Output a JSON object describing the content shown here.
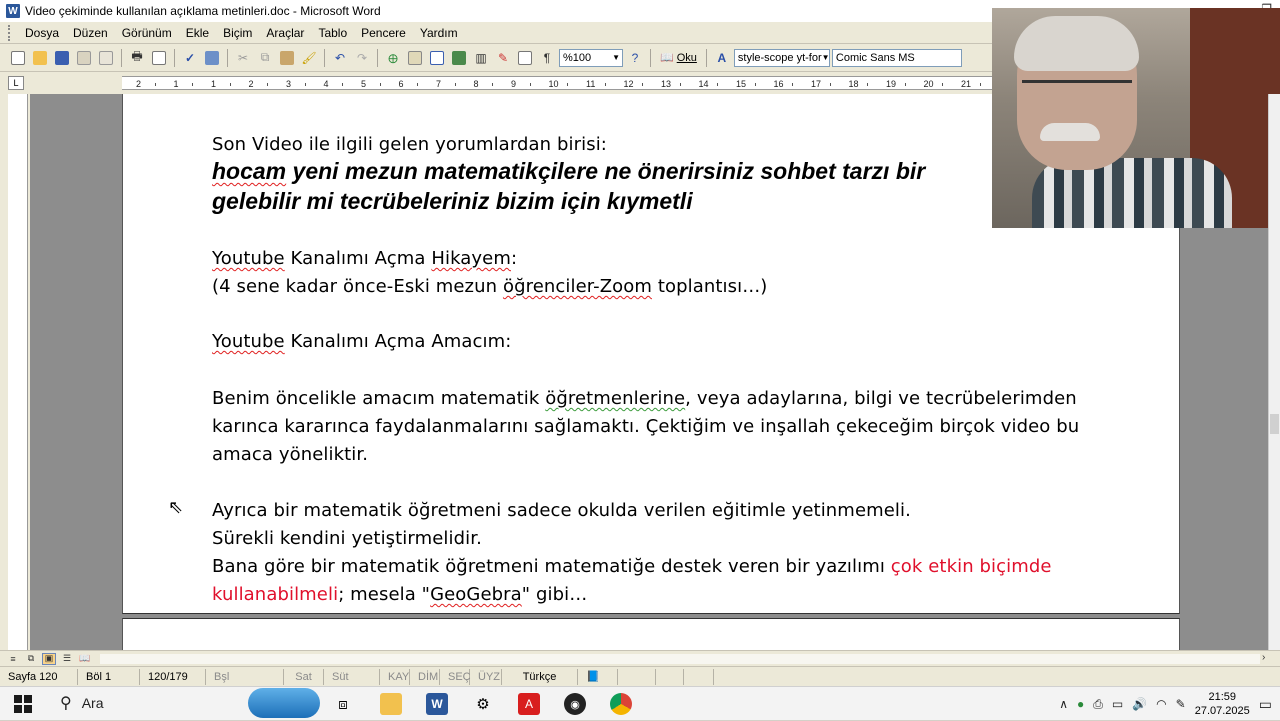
{
  "window": {
    "title": "Video çekiminde kullanılan açıklama metinleri.doc - Microsoft Word",
    "app_icon": "W"
  },
  "menu": [
    {
      "label": "Dosya"
    },
    {
      "label": "Düzen"
    },
    {
      "label": "Görünüm"
    },
    {
      "label": "Ekle"
    },
    {
      "label": "Biçim"
    },
    {
      "label": "Araçlar"
    },
    {
      "label": "Tablo"
    },
    {
      "label": "Pencere"
    },
    {
      "label": "Yardım"
    }
  ],
  "toolbar": {
    "zoom": "%100",
    "read_label": "Oku",
    "style": "style-scope yt-for",
    "font": "Comic Sans MS",
    "paragraph_mark": "¶"
  },
  "ruler": {
    "ticks": [
      "2",
      "1",
      "1",
      "2",
      "3",
      "4",
      "5",
      "6",
      "7",
      "8",
      "9",
      "10",
      "11",
      "12",
      "13",
      "14",
      "15",
      "16",
      "17",
      "18",
      "19",
      "20",
      "21"
    ]
  },
  "document": {
    "line1": "Son Video ile ilgili gelen yorumlardan birisi:",
    "quote1_a": "hocam",
    "quote1_b": " yeni mezun matematikçilere ne önerirsiniz sohbet tarzı bir",
    "quote2": "gelebilir mi tecrübeleriniz bizim için kıymetli",
    "story_a": "Youtube",
    "story_b": " Kanalımı Açma ",
    "story_c": "Hikayem",
    "story_d": ":",
    "story_sub_a": "(4 sene kadar önce-Eski mezun ",
    "story_sub_b": "öğrenciler-Zoom",
    "story_sub_c": " toplantısı…)",
    "purpose_a": "Youtube",
    "purpose_b": " Kanalımı Açma Amacım:",
    "p1_l1_a": "Benim öncelikle amacım matematik ",
    "p1_l1_b": "öğretmenlerine",
    "p1_l1_c": ", veya adaylarına, bilgi ve tecrübelerimden",
    "p1_l2": "karınca kararınca faydalanmalarını sağlamaktı. Çektiğim ve inşallah çekeceğim birçok video bu",
    "p1_l3": "amaca yöneliktir.",
    "p2_l1": "Ayrıca bir matematik öğretmeni sadece okulda verilen eğitimle yetinmemeli.",
    "p2_l2": "Sürekli kendini yetiştirmelidir.",
    "p2_l3_a": "Bana göre bir matematik öğretmeni matematiğe destek veren bir yazılımı ",
    "p2_l3_b": "çok etkin biçimde",
    "p2_l4_a": "kullanabilmeli",
    "p2_l4_b": "; mesela \"",
    "p2_l4_c": "GeoGebra",
    "p2_l4_d": "\" gibi…"
  },
  "statusbar": {
    "page": "Sayfa 120",
    "section": "Böl 1",
    "pages": "120/179",
    "at": "Bşl",
    "line": "Sat",
    "col": "Süt",
    "rec": "KAY",
    "trk": "DİM",
    "ext": "SEÇ",
    "ovr": "ÜYZ",
    "language": "Türkçe"
  },
  "taskbar": {
    "search_label": "Ara",
    "time": "21:59",
    "date": "27.07.2025"
  },
  "colors": {
    "accent_red": "#e0102c",
    "spell_red": "#e02020",
    "grammar_green": "#3a9a3a"
  }
}
